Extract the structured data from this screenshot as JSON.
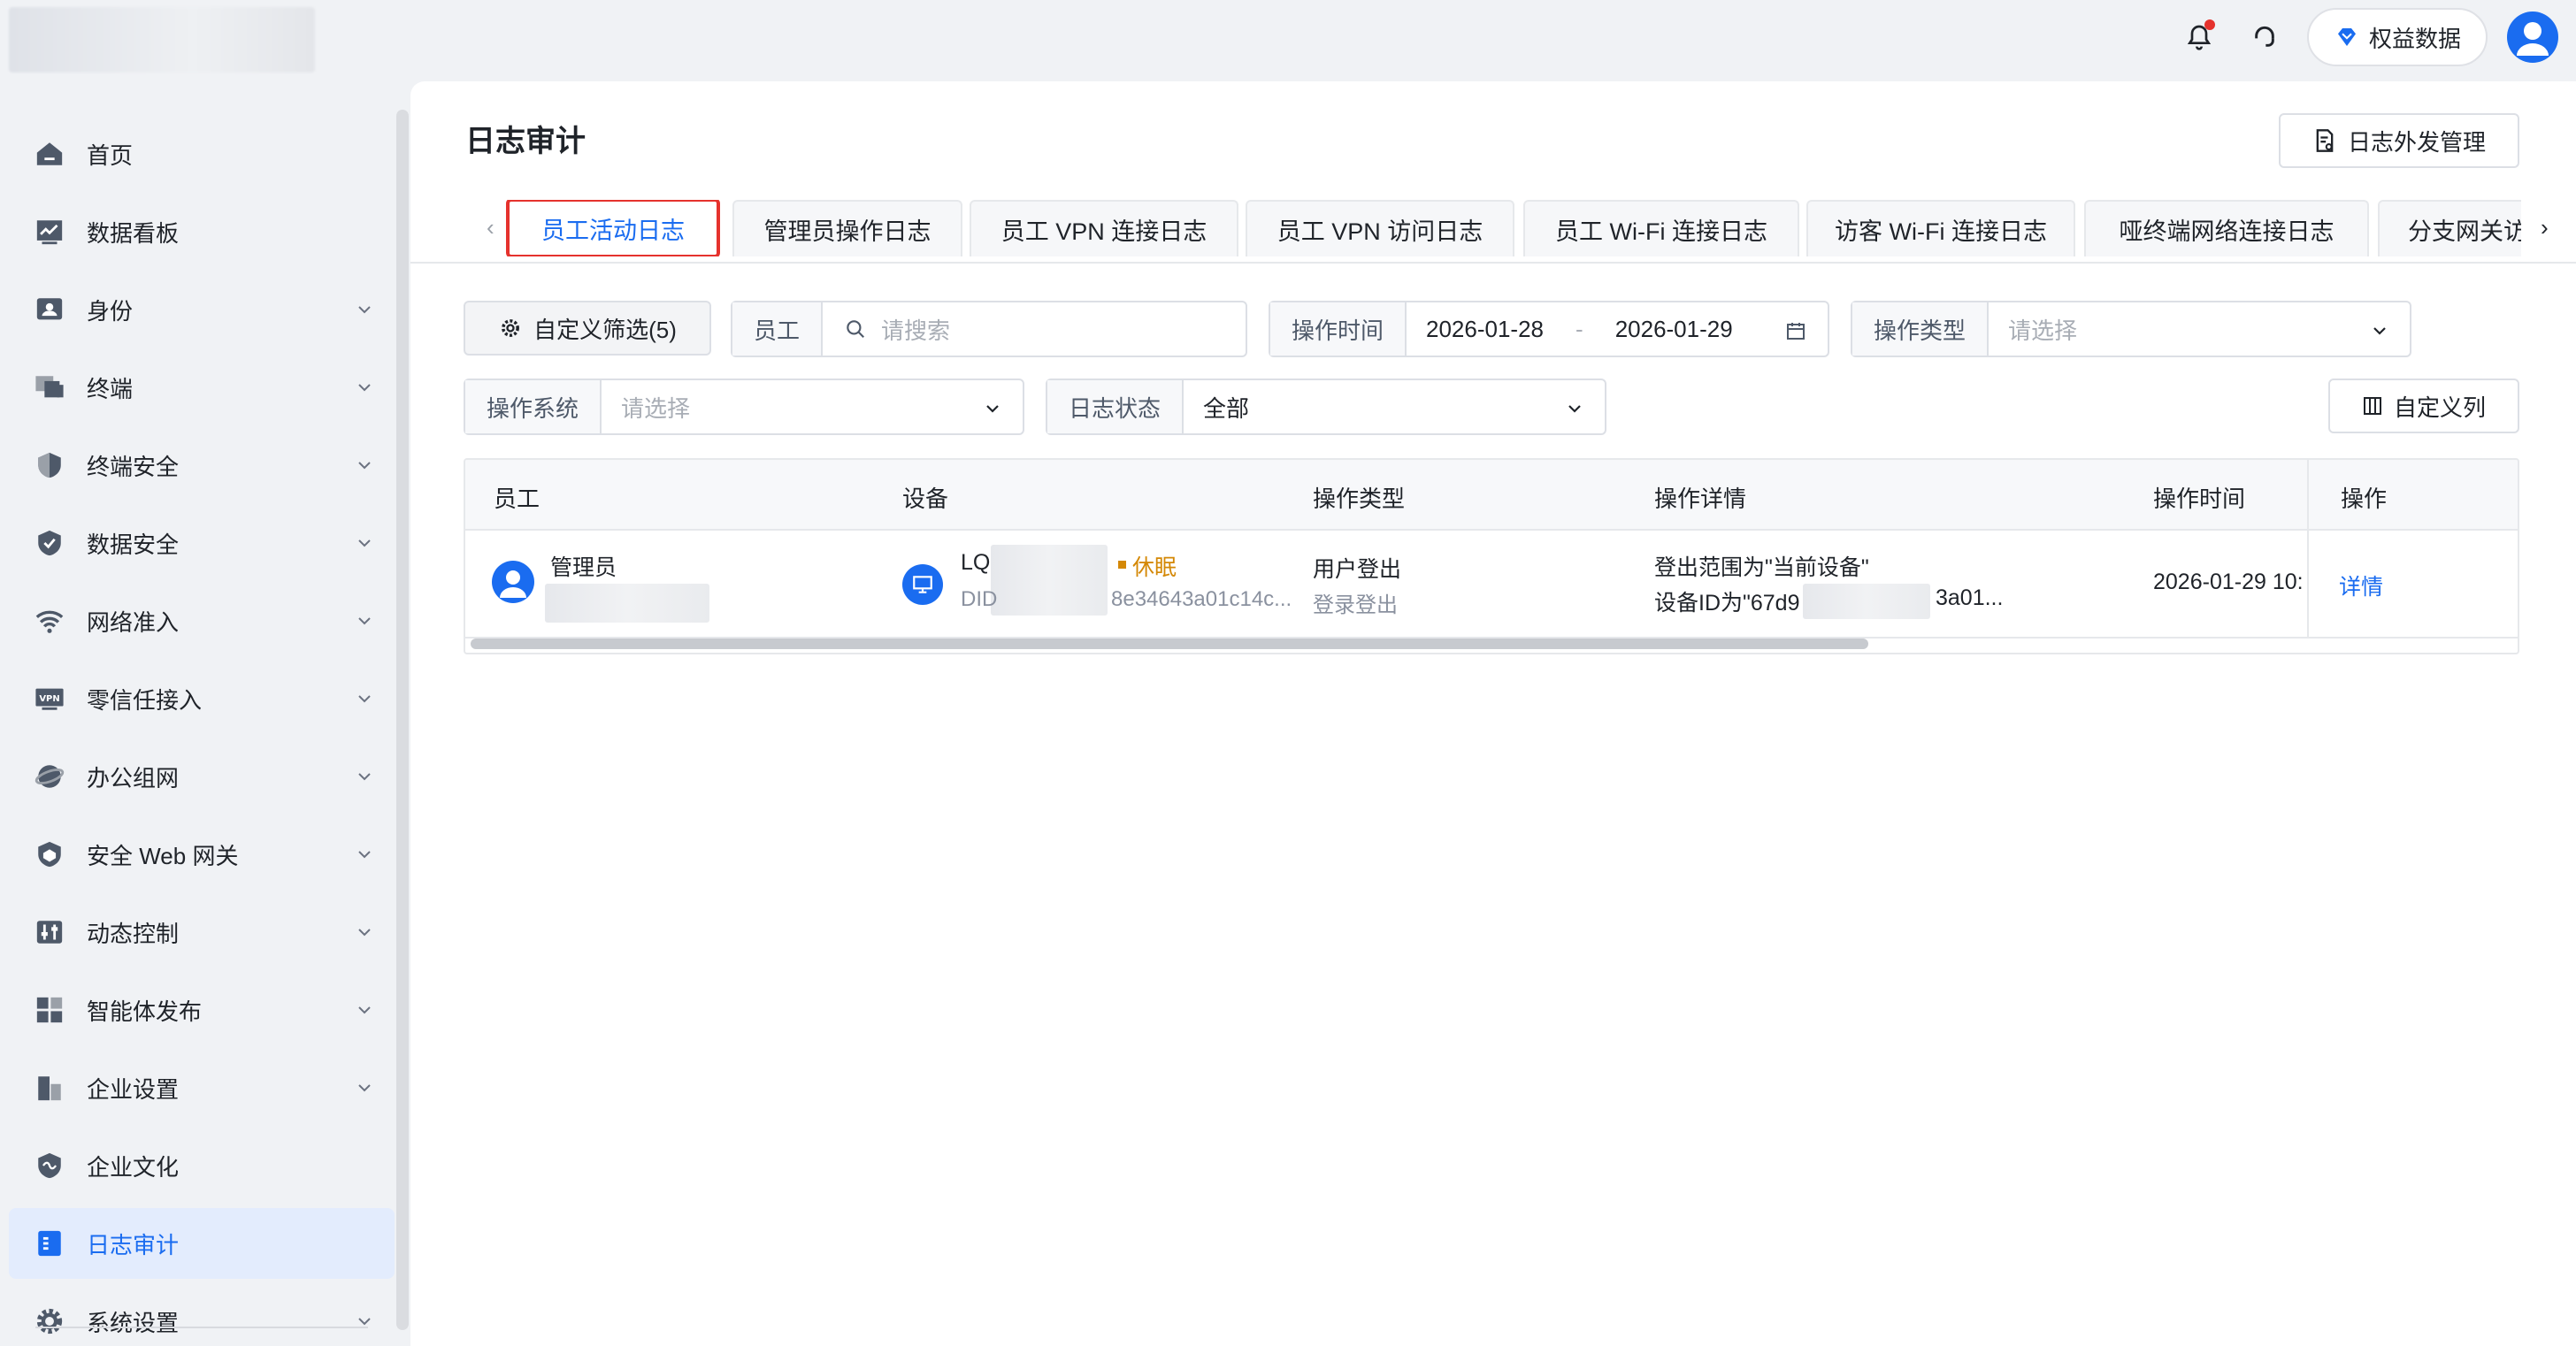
{
  "topbar": {
    "benefit_label": "权益数据"
  },
  "sidebar": {
    "items": [
      {
        "label": "首页",
        "icon": "home-icon"
      },
      {
        "label": "数据看板",
        "icon": "dashboard-icon"
      },
      {
        "label": "身份",
        "icon": "id-card-icon"
      },
      {
        "label": "终端",
        "icon": "devices-icon"
      },
      {
        "label": "终端安全",
        "icon": "shield-icon"
      },
      {
        "label": "数据安全",
        "icon": "shield-check-icon"
      },
      {
        "label": "网络准入",
        "icon": "wifi-icon"
      },
      {
        "label": "零信任接入",
        "icon": "vpn-icon"
      },
      {
        "label": "办公组网",
        "icon": "network-icon"
      },
      {
        "label": "安全 Web 网关",
        "icon": "gateway-icon"
      },
      {
        "label": "动态控制",
        "icon": "control-icon"
      },
      {
        "label": "智能体发布",
        "icon": "apps-icon"
      },
      {
        "label": "企业设置",
        "icon": "building-icon"
      },
      {
        "label": "企业文化",
        "icon": "culture-icon"
      },
      {
        "label": "日志审计",
        "icon": "log-icon"
      },
      {
        "label": "系统设置",
        "icon": "gear-icon"
      }
    ],
    "active_index": 14
  },
  "page": {
    "title": "日志审计",
    "export_button": "日志外发管理"
  },
  "tabs": [
    "员工活动日志",
    "管理员操作日志",
    "员工 VPN 连接日志",
    "员工 VPN 访问日志",
    "员工 Wi-Fi 连接日志",
    "访客 Wi-Fi 连接日志",
    "哑终端网络连接日志",
    "分支网关访"
  ],
  "filters": {
    "custom_filter": "自定义筛选(5)",
    "employee_label": "员工",
    "employee_placeholder": "请搜索",
    "time_label": "操作时间",
    "date_start": "2026-01-28",
    "date_sep": "-",
    "date_end": "2026-01-29",
    "op_type_label": "操作类型",
    "op_type_placeholder": "请选择",
    "os_label": "操作系统",
    "os_placeholder": "请选择",
    "log_status_label": "日志状态",
    "log_status_value": "全部",
    "custom_columns": "自定义列"
  },
  "table": {
    "headers": [
      "员工",
      "设备",
      "操作类型",
      "操作详情",
      "操作时间",
      "操作"
    ],
    "rows": [
      {
        "employee": "管理员",
        "device_name": "LQ",
        "device_status": "休眠",
        "device_id_prefix": "DID",
        "device_id_suffix": "8e34643a01c14c...",
        "op_type": "用户登出",
        "op_sub": "登录登出",
        "detail_line1": "登出范围为\"当前设备\"",
        "detail_line2_prefix": "设备ID为\"67d9",
        "detail_line2_suffix": "3a01...",
        "time": "2026-01-29 10:",
        "action": "详情"
      }
    ]
  },
  "colors": {
    "primary": "#1a6cf0",
    "highlight_border": "#e5322d",
    "status_sleep": "#d48806"
  }
}
